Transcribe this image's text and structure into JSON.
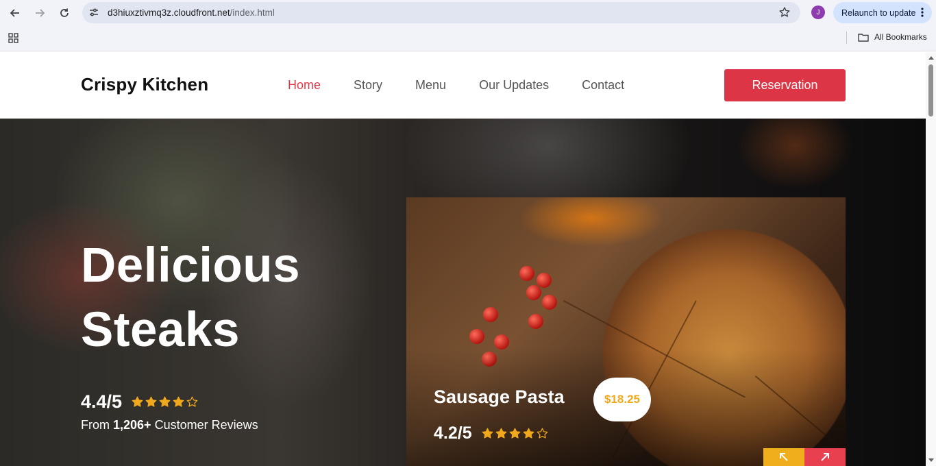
{
  "browser": {
    "url_host": "d3hiuxztivmq3z.cloudfront.net",
    "url_path": "/index.html",
    "avatar_initial": "J",
    "relaunch_label": "Relaunch to update",
    "all_bookmarks_label": "All Bookmarks"
  },
  "site": {
    "brand": "Crispy Kitchen",
    "nav": [
      {
        "label": "Home",
        "active": true
      },
      {
        "label": "Story"
      },
      {
        "label": "Menu"
      },
      {
        "label": "Our Updates"
      },
      {
        "label": "Contact"
      }
    ],
    "reservation_label": "Reservation"
  },
  "hero": {
    "title_line1": "Delicious",
    "title_line2": "Steaks",
    "rating_score": "4.4/5",
    "rating_stars": 4,
    "reviews_prefix": "From ",
    "reviews_count": "1,206+",
    "reviews_suffix": " Customer Reviews"
  },
  "featured": {
    "dish_name": "Sausage Pasta",
    "price": "$18.25",
    "rating_score": "4.2/5",
    "rating_stars": 4
  },
  "colors": {
    "accent_red": "#dc3545",
    "nav_active": "#e03a4a",
    "star": "#f0a81d",
    "prev_button": "#f0ad1c",
    "next_button": "#e8404f"
  }
}
